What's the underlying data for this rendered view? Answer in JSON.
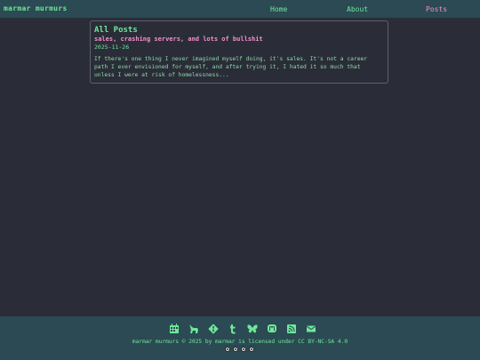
{
  "header": {
    "site_title": "marmar murmurs",
    "nav": [
      {
        "label": "Home"
      },
      {
        "label": "About"
      },
      {
        "label": "Posts"
      }
    ]
  },
  "main": {
    "heading": "All Posts",
    "posts": [
      {
        "title": "sales, crashing servers, and lots of bullshit",
        "date": "2025-11-26",
        "excerpt": "If there's one thing I never imagined myself doing, it's sales. It's not a career path I ever envisioned for myself, and after trying it, I hated it so much that unless I were at risk of homelessness..."
      }
    ]
  },
  "footer": {
    "icons": [
      "calendar-icon",
      "deer-icon",
      "git-icon",
      "tumblr-icon",
      "butterfly-icon",
      "mastodon-icon",
      "rss-icon",
      "email-icon"
    ],
    "license_text": "marmar murmurs © 2025 by marmar is licensed under CC BY-NC-SA 4.0",
    "cc_badges": [
      "cc-icon",
      "by-icon",
      "nc-icon",
      "sa-icon"
    ]
  },
  "colors": {
    "background": "#2a2d38",
    "bar": "#2b4a53",
    "accent_green": "#6ee89a",
    "accent_pink": "#f48fc8"
  }
}
